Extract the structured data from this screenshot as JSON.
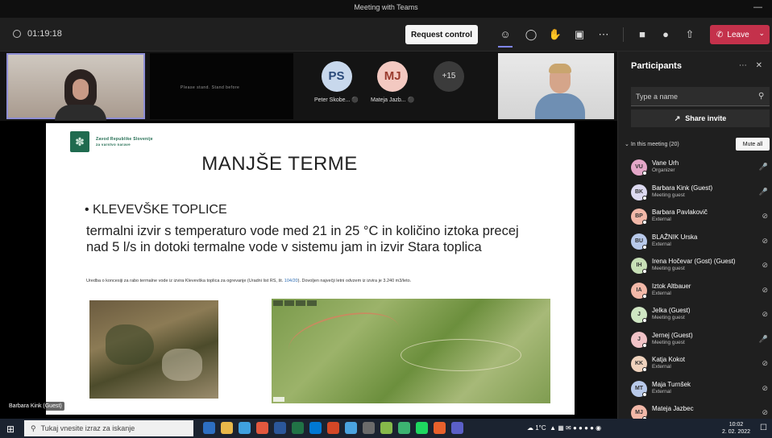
{
  "window": {
    "title": "Meeting with Teams"
  },
  "toolbar": {
    "timer": "01:19:18",
    "request_control_label": "Request control",
    "leave_label": "Leave"
  },
  "gallery": {
    "shared_screen_text": "Please stand. Stand before",
    "participant_avatars": [
      {
        "initials": "PS",
        "name": "Peter Skobe..."
      },
      {
        "initials": "MJ",
        "name": "Mateja Jazb..."
      }
    ],
    "more_count": "+15"
  },
  "slide": {
    "org_line1": "Zavod Republike Slovenije",
    "org_line2": "za varstvo narave",
    "title": "MANJŠE TERME",
    "bullet": "• KLEVEVŠKE TOPLICE",
    "paragraph": "termalni izvir s temperaturo vode med 21 in 25 °C in količino iztoka precej nad 5 l/s in dotoki termalne vode v sistemu jam in izvir Stara toplica",
    "small_before": "Uredba o koncesiji za rabo termalne vode iz izvira Klevevška toplica za ogrevanje (Uradni list RS, št. ",
    "small_link": "104/20",
    "small_after": "). Dovoljen največji letni odvzem iz izvira je 3.240 m3/leto.",
    "presenter_label": "Barbara Kink (Guest)"
  },
  "panel": {
    "title": "Participants",
    "search_placeholder": "Type a name",
    "share_invite_label": "Share invite",
    "in_meeting_label": "In this meeting (20)",
    "mute_all_label": "Mute all",
    "participants": [
      {
        "initials": "VU",
        "name": "Vane Urh",
        "role": "Organizer",
        "color": "#e4a7c8",
        "mic": "on"
      },
      {
        "initials": "BK",
        "name": "Barbara Kink (Guest)",
        "role": "Meeting guest",
        "color": "#dcd9f0",
        "mic": "on"
      },
      {
        "initials": "BP",
        "name": "Barbara Pavlakovič",
        "role": "External",
        "color": "#f2b8a8",
        "mic": "off"
      },
      {
        "initials": "BU",
        "name": "BLAŽNIK Urska",
        "role": "External",
        "color": "#b8c9ea",
        "mic": "off"
      },
      {
        "initials": "IH",
        "name": "Irena Hočevar (Gost) (Guest)",
        "role": "Meeting guest",
        "color": "#c7dfb6",
        "mic": "off"
      },
      {
        "initials": "IA",
        "name": "Iztok Altbauer",
        "role": "External",
        "color": "#f2b8a8",
        "mic": "off"
      },
      {
        "initials": "J",
        "name": "Jelka (Guest)",
        "role": "Meeting guest",
        "color": "#cfe6c3",
        "mic": "off"
      },
      {
        "initials": "J",
        "name": "Jernej (Guest)",
        "role": "Meeting guest",
        "color": "#f0c2c6",
        "mic": "on"
      },
      {
        "initials": "KK",
        "name": "Katja Kokot",
        "role": "External",
        "color": "#efd2bd",
        "mic": "off"
      },
      {
        "initials": "MT",
        "name": "Maja Turnšek",
        "role": "External",
        "color": "#b8c9ea",
        "mic": "off"
      },
      {
        "initials": "MJ",
        "name": "Mateja Jazbec",
        "role": "",
        "color": "#f2b8a8",
        "mic": "off"
      }
    ]
  },
  "taskbar": {
    "search_placeholder": "Tukaj vnesite izraz za iskanje",
    "temperature": "1°C",
    "time": "10:02",
    "date": "2. 02. 2022"
  }
}
